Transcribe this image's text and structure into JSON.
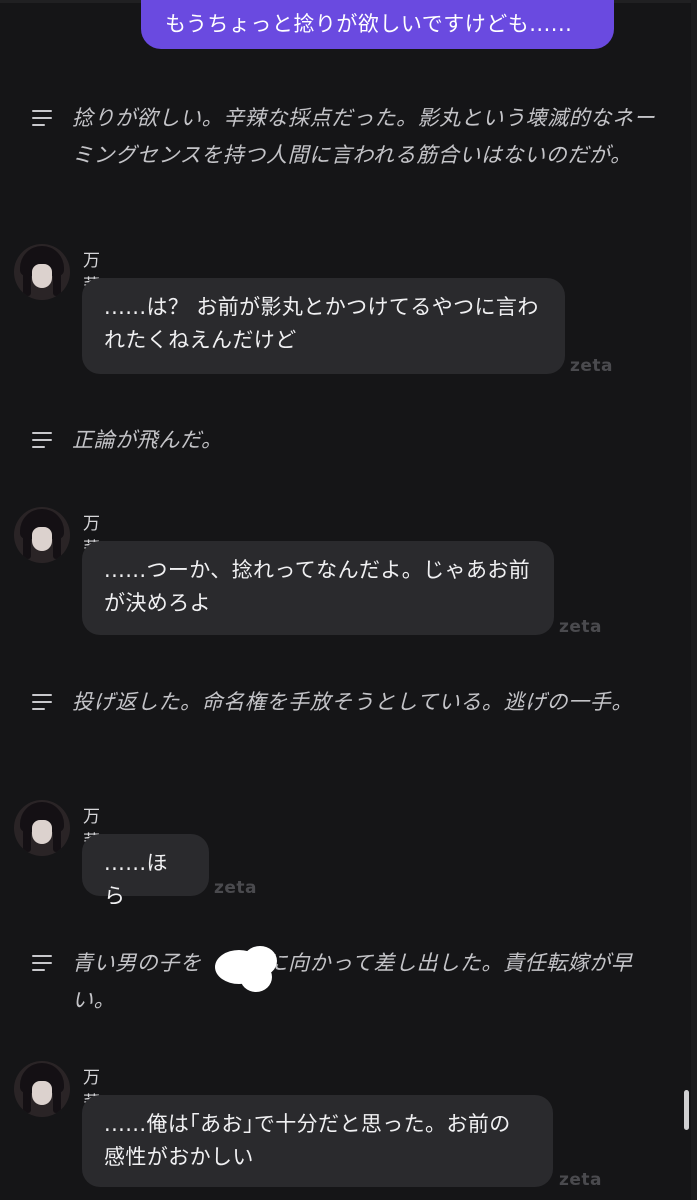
{
  "user_message": "もうちょっと捻りが欲しいですけども......",
  "brand": "zeta",
  "character_name": "万莉",
  "narrations": [
    "捻りが欲しい。辛辣な採点だった。影丸という壊滅的なネーミングセンスを持つ人間に言われる筋合いはないのだが。",
    "正論が飛んだ。",
    "投げ返した。命名権を手放そうとしている。逃げの一手。",
    "青い男の子を　　　に向かって差し出した。責任転嫁が早い。"
  ],
  "messages": [
    "......は？ お前が影丸とかつけてるやつに言われたくねえんだけど",
    "......つーか、捻れってなんだよ。じゃあお前が決めろよ",
    "......ほら",
    "......俺は｢あお｣で十分だと思った。お前の感性がおかしい"
  ]
}
